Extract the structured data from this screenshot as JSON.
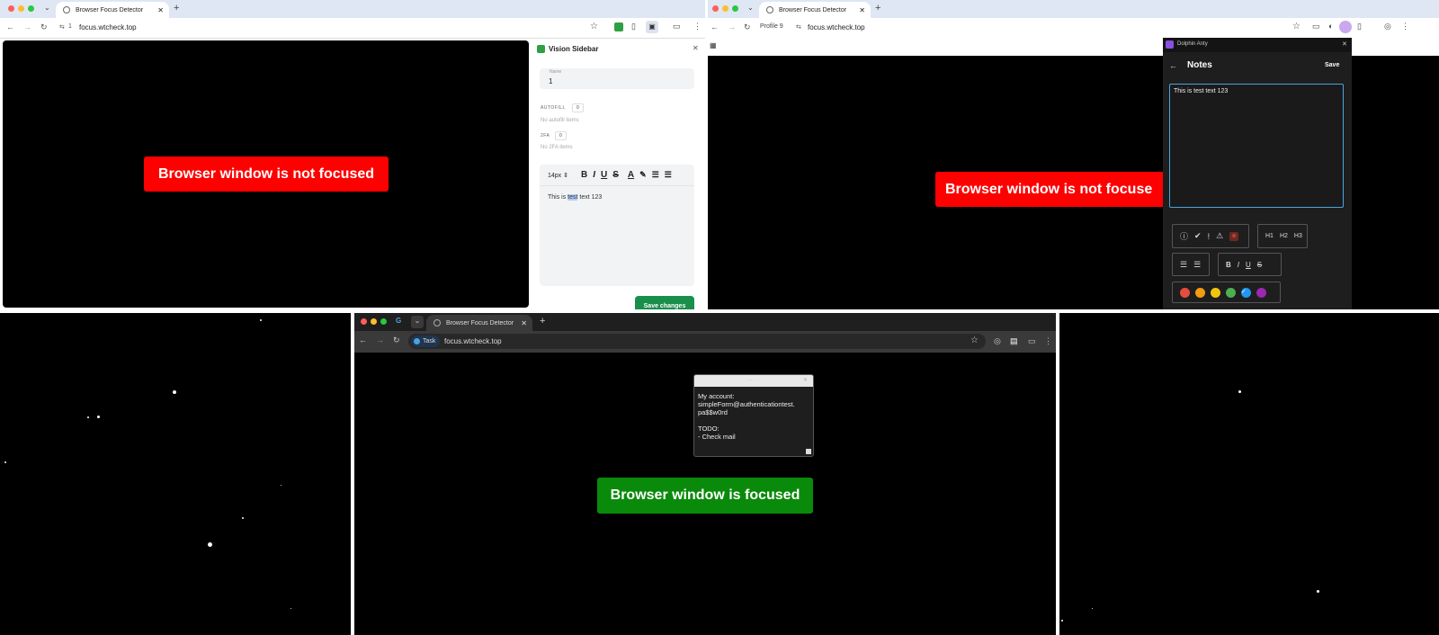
{
  "panel1": {
    "tab_title": "Browser Focus Detector",
    "url": "focus.wtcheck.top",
    "profile": "1",
    "banner": "Browser window is not focused",
    "sidebar": {
      "title": "Vision Sidebar",
      "name_label": "Name",
      "name_value": "1",
      "autofill_label": "AUTOFILL",
      "autofill_count": "0",
      "autofill_empty": "No autofill items",
      "twofa_label": "2FA",
      "twofa_count": "0",
      "twofa_empty": "No 2FA items",
      "font_size": "14px",
      "editor_text_before": "This is ",
      "editor_text_selected": "test",
      "editor_text_after": " text 123",
      "save_label": "Save changes"
    }
  },
  "panel2": {
    "tab_title": "Browser Focus Detector",
    "profile": "Profile 9",
    "url": "focus.wtcheck.top",
    "banner": "Browser window is not focuse",
    "notes": {
      "window_title": "Dolphin Anty",
      "title": "Notes",
      "save_label": "Save",
      "text": "This is test text 123",
      "headings": [
        "H1",
        "H2",
        "H3"
      ],
      "colors": [
        "#e74c3c",
        "#f39c12",
        "#f1c40f",
        "#4caf50",
        "#2196f3",
        "#9c27b0"
      ]
    }
  },
  "panel3": {
    "tab_title": "Browser Focus Detector",
    "task_label": "Task",
    "url": "focus.wtcheck.top",
    "banner": "Browser window is focused",
    "note_lines": [
      "My account:",
      "simpleForm@authenticationtest.",
      "pa$$w0rd",
      "",
      "TODO:",
      "- Check mail"
    ]
  },
  "colors": {
    "banner_red": "#ff0000",
    "banner_green": "#0a8a0a",
    "save_green": "#1a8f4c",
    "tab_bar": "#dfe6f4",
    "dark_chrome": "#2b2b2b"
  }
}
